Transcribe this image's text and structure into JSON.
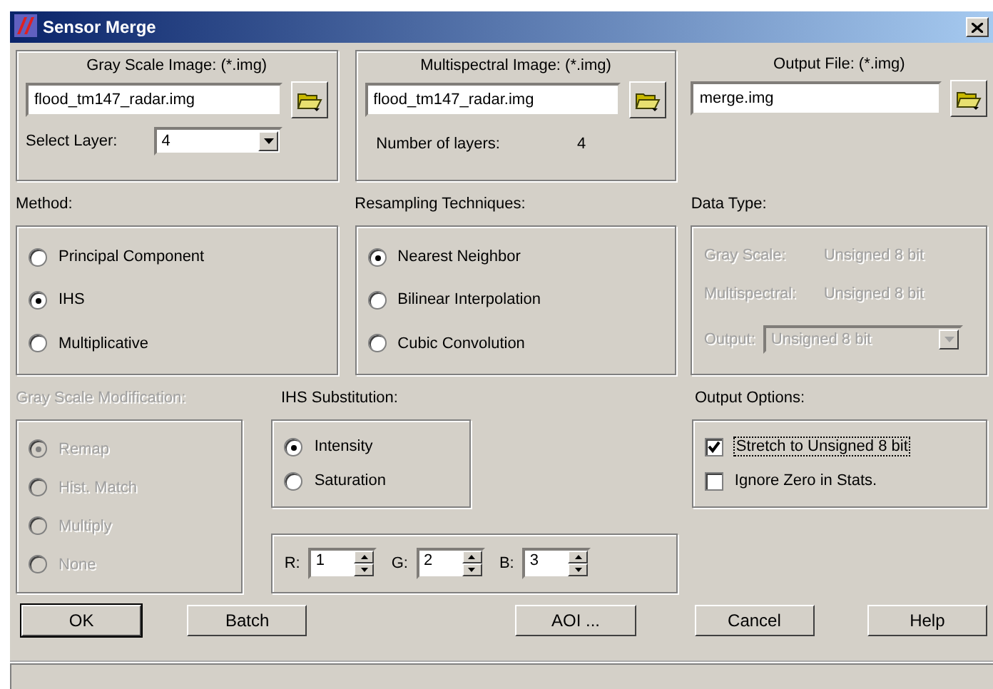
{
  "window": {
    "title": "Sensor Merge"
  },
  "gray_scale_image": {
    "label": "Gray Scale Image: (*.img)",
    "value": "flood_tm147_radar.img",
    "layer_label": "Select Layer:",
    "layer": "4"
  },
  "multispectral_image": {
    "label": "Multispectral Image: (*.img)",
    "value": "flood_tm147_radar.img",
    "layers_label": "Number of layers:",
    "layers": "4"
  },
  "output_file": {
    "label": "Output File: (*.img)",
    "value": "merge.img"
  },
  "method": {
    "label": "Method:",
    "disabled": false,
    "options": [
      {
        "label": "Principal Component",
        "selected": false
      },
      {
        "label": "IHS",
        "selected": true
      },
      {
        "label": "Multiplicative",
        "selected": false
      }
    ]
  },
  "resampling": {
    "label": "Resampling Techniques:",
    "disabled": false,
    "options": [
      {
        "label": "Nearest Neighbor",
        "selected": true
      },
      {
        "label": "Bilinear Interpolation",
        "selected": false
      },
      {
        "label": "Cubic Convolution",
        "selected": false
      }
    ]
  },
  "data_type": {
    "label": "Data Type:",
    "disabled": true,
    "rows": [
      {
        "kind": "text",
        "label": "Gray Scale:",
        "value": "Unsigned 8 bit"
      },
      {
        "kind": "text",
        "label": "Multispectral:",
        "value": "Unsigned 8 bit"
      },
      {
        "kind": "dropdown",
        "label": "Output:",
        "value": "Unsigned 8 bit"
      }
    ]
  },
  "gray_scale_modification": {
    "label": "Gray Scale Modification:",
    "disabled": true,
    "options": [
      {
        "label": "Remap",
        "selected": true
      },
      {
        "label": "Hist. Match",
        "selected": false
      },
      {
        "label": "Multiply",
        "selected": false
      },
      {
        "label": "None",
        "selected": false
      }
    ]
  },
  "ihs_substitution": {
    "label": "IHS Substitution:",
    "disabled": false,
    "options": [
      {
        "label": "Intensity",
        "selected": true
      },
      {
        "label": "Saturation",
        "selected": false
      }
    ]
  },
  "bands": [
    {
      "label": "R:",
      "value": "1"
    },
    {
      "label": "G:",
      "value": "2"
    },
    {
      "label": "B:",
      "value": "3"
    }
  ],
  "output_options": {
    "label": "Output Options:",
    "options": [
      {
        "label": "Stretch to Unsigned 8 bit",
        "checked": true,
        "focused": true
      },
      {
        "label": "Ignore Zero in Stats.",
        "checked": false,
        "focused": false
      }
    ]
  },
  "buttons": [
    {
      "label": "OK",
      "default": true
    },
    {
      "label": "Batch",
      "default": false
    },
    {
      "label": "AOI ...",
      "default": false
    },
    {
      "label": "Cancel",
      "default": false
    },
    {
      "label": "Help",
      "default": false
    }
  ]
}
